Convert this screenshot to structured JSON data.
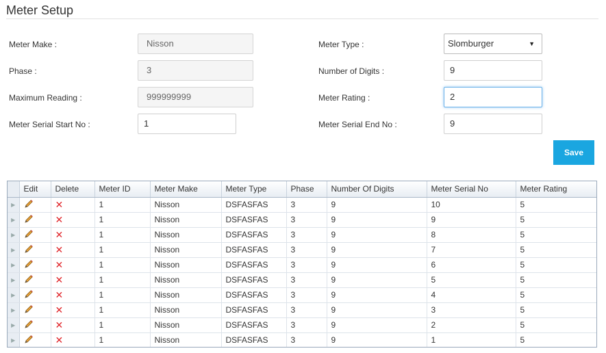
{
  "page": {
    "title": "Meter Setup"
  },
  "form": {
    "meter_make_label": "Meter Make :",
    "meter_make_value": "Nisson",
    "phase_label": "Phase :",
    "phase_value": "3",
    "max_reading_label": "Maximum Reading :",
    "max_reading_value": "999999999",
    "serial_start_label": "Meter Serial Start No :",
    "serial_start_value": "1",
    "meter_type_label": "Meter Type :",
    "meter_type_value": "Slomburger",
    "digits_label": "Number of Digits :",
    "digits_value": "9",
    "rating_label": "Meter Rating :",
    "rating_value": "2",
    "serial_end_label": "Meter Serial End No :",
    "serial_end_value": "9",
    "save_label": "Save"
  },
  "grid": {
    "columns": [
      "Edit",
      "Delete",
      "Meter ID",
      "Meter Make",
      "Meter Type",
      "Phase",
      "Number Of Digits",
      "Meter Serial No",
      "Meter Rating"
    ],
    "rows": [
      [
        "1",
        "Nisson",
        "DSFASFAS",
        "3",
        "9",
        "10",
        "5"
      ],
      [
        "1",
        "Nisson",
        "DSFASFAS",
        "3",
        "9",
        "9",
        "5"
      ],
      [
        "1",
        "Nisson",
        "DSFASFAS",
        "3",
        "9",
        "8",
        "5"
      ],
      [
        "1",
        "Nisson",
        "DSFASFAS",
        "3",
        "9",
        "7",
        "5"
      ],
      [
        "1",
        "Nisson",
        "DSFASFAS",
        "3",
        "9",
        "6",
        "5"
      ],
      [
        "1",
        "Nisson",
        "DSFASFAS",
        "3",
        "9",
        "5",
        "5"
      ],
      [
        "1",
        "Nisson",
        "DSFASFAS",
        "3",
        "9",
        "4",
        "5"
      ],
      [
        "1",
        "Nisson",
        "DSFASFAS",
        "3",
        "9",
        "3",
        "5"
      ],
      [
        "1",
        "Nisson",
        "DSFASFAS",
        "3",
        "9",
        "2",
        "5"
      ],
      [
        "1",
        "Nisson",
        "DSFASFAS",
        "3",
        "9",
        "1",
        "5"
      ]
    ]
  },
  "icons": {
    "edit": "pencil-icon",
    "delete": "cross-icon",
    "row_indicator": "triangle-right-icon",
    "dropdown": "caret-down-icon"
  },
  "colors": {
    "save_button": "#1aa6e0",
    "delete_icon": "#e0262b",
    "focus_border": "#66afe9"
  }
}
